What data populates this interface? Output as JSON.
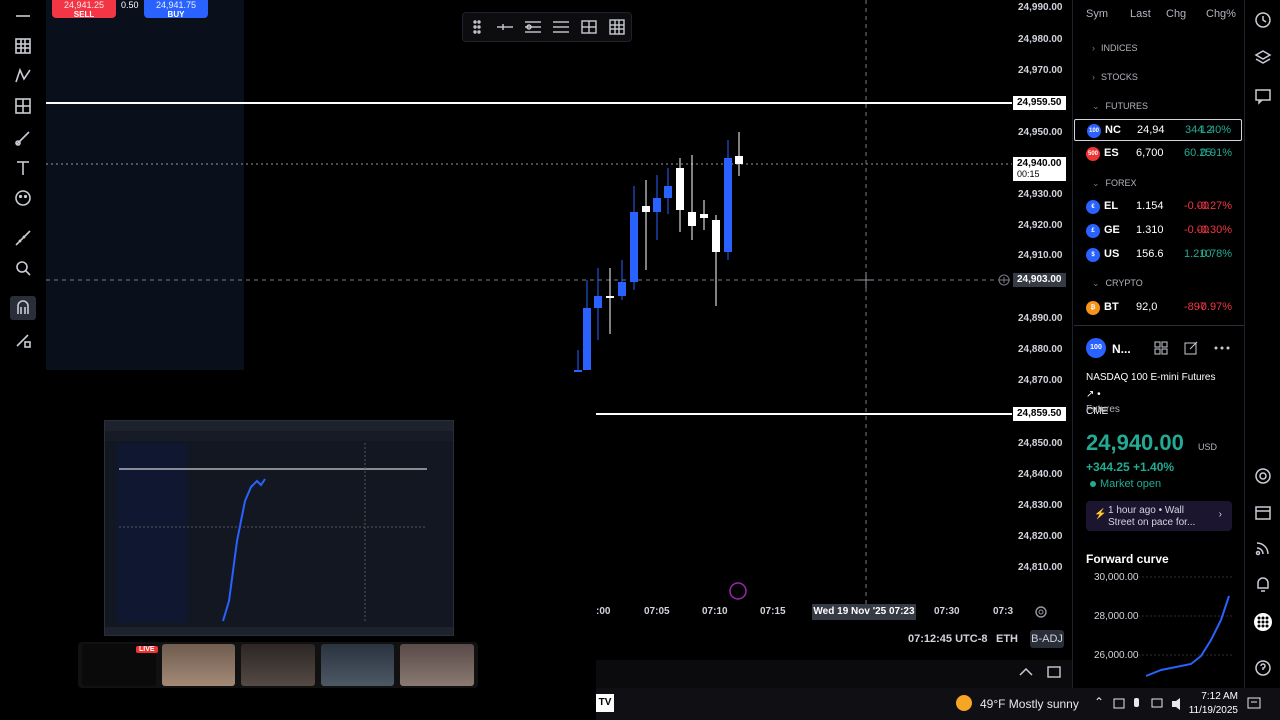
{
  "trade": {
    "sell_price": "24,941.25",
    "sell_label": "SELL",
    "spread": "0.50",
    "buy_price": "24,941.75",
    "buy_label": "BUY"
  },
  "price_axis": [
    "24,990.00",
    "24,980.00",
    "24,970.00",
    "24,950.00",
    "24,930.00",
    "24,920.00",
    "24,910.00",
    "24,890.00",
    "24,880.00",
    "24,870.00",
    "24,850.00",
    "24,840.00",
    "24,830.00",
    "24,820.00",
    "24,810.00"
  ],
  "price_labels": {
    "upper_line": "24,959.50",
    "current": "24,940.00",
    "countdown": "00:15",
    "crosshair": "24,903.00",
    "lower_line": "24,859.50"
  },
  "time_axis": [
    ":00",
    "07:05",
    "07:10",
    "07:15",
    "07:30",
    "07:3"
  ],
  "time_cursor": "Wed 19 Nov '25   07:23",
  "status": {
    "clock": "07:12:45 UTC-8",
    "session": "ETH",
    "adjust": "B-ADJ"
  },
  "watchlist": {
    "columns": [
      "Sym",
      "Last",
      "Chg",
      "Chg%"
    ],
    "sections": {
      "indices": "INDICES",
      "stocks": "STOCKS",
      "futures": "FUTURES",
      "forex": "FOREX",
      "crypto": "CRYPTO"
    },
    "rows": [
      {
        "icon": "100",
        "sym": "NC",
        "last": "24,94",
        "chg": "344.2",
        "pct": "1.40%",
        "color": "#2962ff"
      },
      {
        "icon": "500",
        "sym": "ES",
        "last": "6,700",
        "chg": "60.25",
        "pct": "0.91%",
        "color": "#e33"
      },
      {
        "icon": "€",
        "sym": "EL",
        "last": "1.154",
        "chg": "-0.00",
        "pct": "-0.27%",
        "color": "#2962ff"
      },
      {
        "icon": "£",
        "sym": "GE",
        "last": "1.310",
        "chg": "-0.00",
        "pct": "-0.30%",
        "color": "#2962ff"
      },
      {
        "icon": "$",
        "sym": "US",
        "last": "156.6",
        "chg": "1.210",
        "pct": "0.78%",
        "color": "#2962ff"
      },
      {
        "icon": "₿",
        "sym": "BT",
        "last": "92,0",
        "chg": "-897",
        "pct": "-0.97%",
        "color": "#f7931a"
      }
    ]
  },
  "detail": {
    "icon": "100",
    "symbol": "N...",
    "name": "NASDAQ 100 E-mini Futures",
    "exchange": "CME",
    "type": "Futures",
    "price": "24,940.00",
    "currency": "USD",
    "change": "+344.25  +1.40%",
    "market": "Market open",
    "news_time": "1 hour ago",
    "news_text": "Wall Street on pace for...",
    "forward_curve": "Forward curve",
    "fc_ticks": [
      "30,000.00",
      "28,000.00",
      "26,000.00"
    ]
  },
  "taskbar": {
    "weather": "49°F  Mostly sunny",
    "time": "7:12 AM",
    "date": "11/19/2025"
  },
  "overlay": {
    "live": "LIVE"
  },
  "colors": {
    "up_candle": "#ffffff",
    "down_candle": "#2962ff",
    "positive": "#22ab94",
    "negative": "#f23645"
  }
}
